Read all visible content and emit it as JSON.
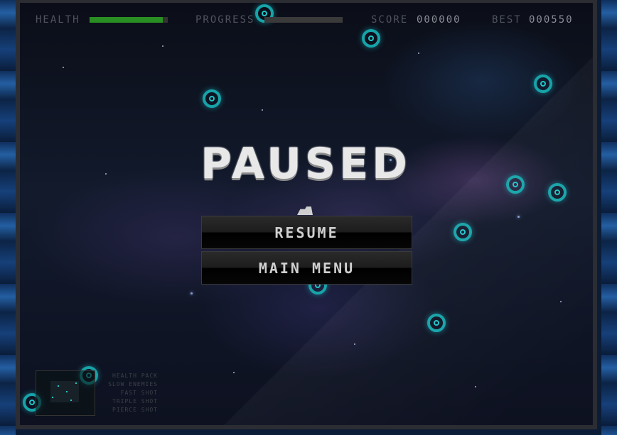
{
  "hud": {
    "health_label": "HEALTH",
    "health_level": 0.94,
    "progress_label": "PROGRESS",
    "progress_level": 0.0,
    "score_label": "SCORE",
    "score_value": "000000",
    "best_label": "BEST",
    "best_value": "000550"
  },
  "pause_menu": {
    "title": "PAUSED",
    "resume_label": "RESUME",
    "main_menu_label": "MAIN MENU"
  },
  "powerups": [
    "HEALTH PACK",
    "SLOW ENEMIES",
    "FAST SHOT",
    "TRIPLE SHOT",
    "PIERCE SHOT"
  ],
  "colors": {
    "health": "#2a8f22",
    "enemy_ring": "#17a3a8",
    "title": "#e8e8e8"
  }
}
